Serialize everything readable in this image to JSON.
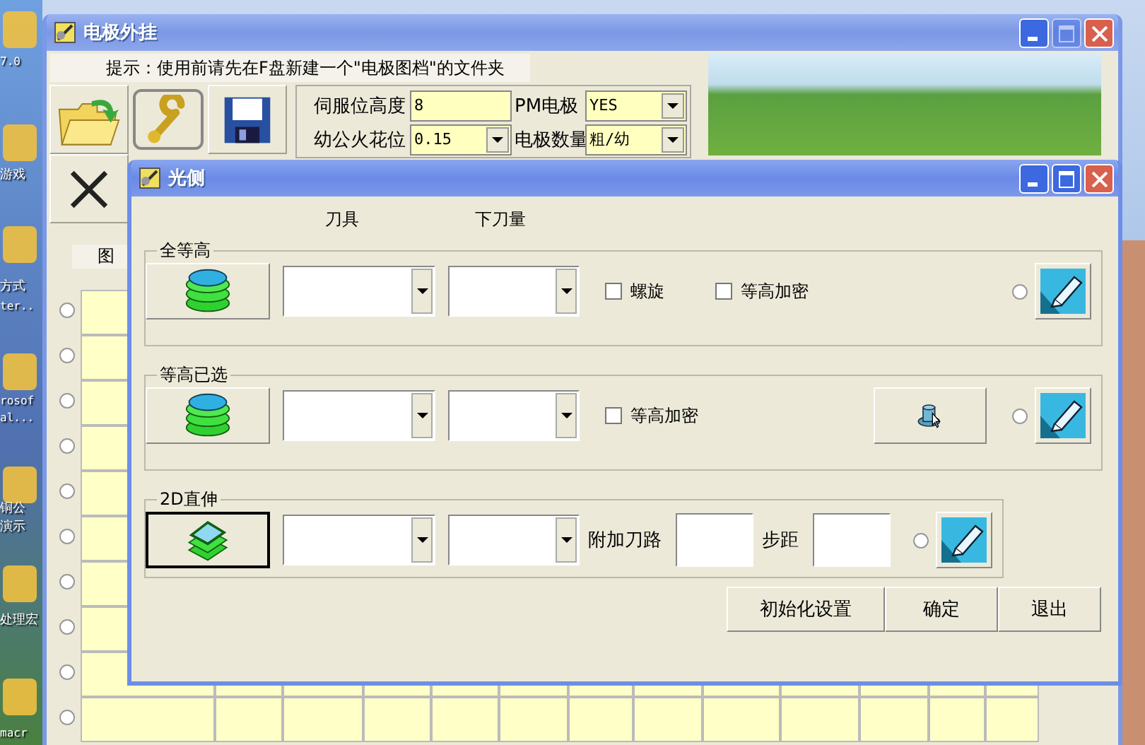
{
  "desktop": {
    "icon_labels": [
      "7.0",
      "游戏",
      "方式",
      "ter..",
      "rosof",
      "al...",
      "铜公",
      "演示",
      "处理宏",
      "macr"
    ]
  },
  "main_window": {
    "title": "电极外挂",
    "maximize_disabled": true,
    "hint": "提示：使用前请先在F盘新建一个\"电极图档\"的文件夹",
    "params": [
      {
        "label": "伺服位高度",
        "value": "8",
        "kind": "input"
      },
      {
        "label": "PM电极",
        "value": "YES",
        "kind": "dropdown"
      },
      {
        "label": "幼公火花位",
        "value": "0.15",
        "kind": "dropdown"
      },
      {
        "label": "电极数量",
        "value": "粗/幼",
        "kind": "dropdown"
      }
    ],
    "list_label": "图",
    "list_rows": [
      {
        "selected": false
      },
      {
        "selected": false
      },
      {
        "selected": false
      },
      {
        "selected": false
      },
      {
        "selected": false
      },
      {
        "selected": false
      },
      {
        "selected": false
      },
      {
        "selected": false
      },
      {
        "selected": false
      },
      {
        "selected": false
      }
    ]
  },
  "dialog": {
    "title": "光侧",
    "maximize_disabled": false,
    "column_headers": [
      "刀具",
      "下刀量"
    ],
    "groups": [
      {
        "title": "全等高",
        "kind": "stack",
        "button_focused": false,
        "checkboxes": [
          {
            "label": "螺旋",
            "checked": false
          },
          {
            "label": "等高加密",
            "checked": false
          }
        ],
        "radio_selected": false
      },
      {
        "title": "等高已选",
        "kind": "stack-select",
        "button_focused": false,
        "checkboxes": [
          {
            "label": "等高加密",
            "checked": false
          }
        ],
        "radio_selected": false
      },
      {
        "title": "2D直伸",
        "kind": "flat",
        "button_focused": true,
        "inputs": [
          {
            "label": "附加刀路"
          },
          {
            "label": "步距"
          }
        ],
        "radio_selected": false
      }
    ],
    "buttons": [
      "初始化设置",
      "确定",
      "退出"
    ]
  }
}
